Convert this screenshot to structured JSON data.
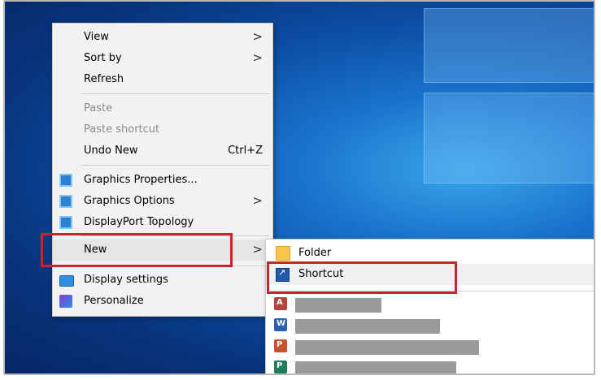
{
  "context_menu": {
    "items": [
      {
        "label": "View",
        "has_submenu": true,
        "disabled": false
      },
      {
        "label": "Sort by",
        "has_submenu": true,
        "disabled": false
      },
      {
        "label": "Refresh",
        "disabled": false
      },
      {
        "label": "Paste",
        "disabled": true
      },
      {
        "label": "Paste shortcut",
        "disabled": true
      },
      {
        "label": "Undo New",
        "shortcut": "Ctrl+Z",
        "disabled": false
      },
      {
        "label": "Graphics Properties...",
        "icon": "intel-graphics-icon"
      },
      {
        "label": "Graphics Options",
        "icon": "intel-graphics-icon",
        "has_submenu": true
      },
      {
        "label": "DisplayPort Topology",
        "icon": "intel-graphics-icon"
      },
      {
        "label": "New",
        "has_submenu": true,
        "highlighted": true
      },
      {
        "label": "Display settings",
        "icon": "monitor-icon"
      },
      {
        "label": "Personalize",
        "icon": "personalize-icon"
      }
    ]
  },
  "new_submenu": {
    "items": [
      {
        "label": "Folder",
        "icon": "folder-icon"
      },
      {
        "label": "Shortcut",
        "icon": "shortcut-icon",
        "highlighted": true
      },
      {
        "label": "",
        "icon": "access-icon",
        "redacted": true
      },
      {
        "label": "",
        "icon": "word-icon",
        "redacted": true
      },
      {
        "label": "",
        "icon": "powerpoint-icon",
        "redacted": true
      },
      {
        "label": "",
        "icon": "publisher-icon",
        "redacted": true
      }
    ]
  },
  "arrow_glyph": ">",
  "colors": {
    "highlight_box": "#c8242c",
    "menu_bg": "#f2f2f2",
    "desktop": "#0c4fa6"
  }
}
